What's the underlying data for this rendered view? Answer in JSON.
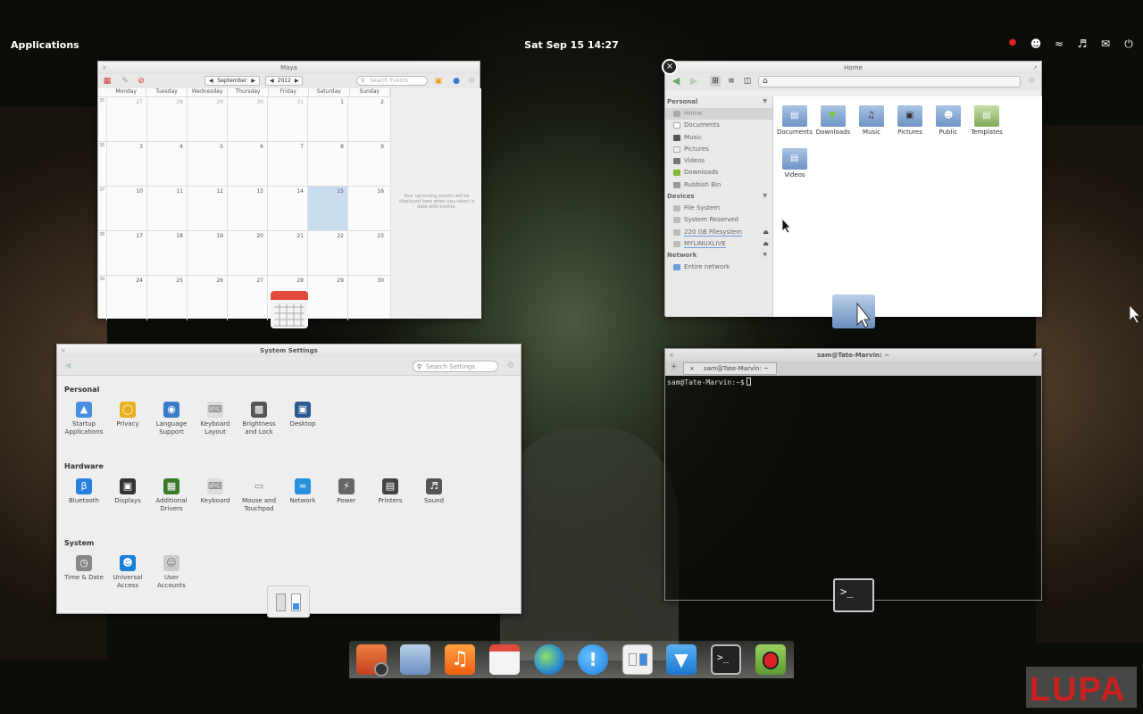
{
  "panel": {
    "applications": "Applications",
    "clock": "Sat Sep 15 14:27",
    "tray_icons": [
      "record-indicator-icon",
      "user-icon",
      "wifi-icon",
      "volume-icon",
      "mail-icon",
      "power-icon"
    ]
  },
  "calendar": {
    "title": "Maya",
    "month": "September",
    "year": "2012",
    "search_placeholder": "Search Events",
    "days": [
      "Monday",
      "Tuesday",
      "Wednesday",
      "Thursday",
      "Friday",
      "Saturday",
      "Sunday"
    ],
    "weeks": [
      {
        "num": "35",
        "dates": [
          "27",
          "28",
          "29",
          "30",
          "31",
          "1",
          "2"
        ]
      },
      {
        "num": "36",
        "dates": [
          "3",
          "4",
          "5",
          "6",
          "7",
          "8",
          "9"
        ]
      },
      {
        "num": "37",
        "dates": [
          "10",
          "11",
          "12",
          "13",
          "14",
          "15",
          "16"
        ]
      },
      {
        "num": "38",
        "dates": [
          "17",
          "18",
          "19",
          "20",
          "21",
          "22",
          "23"
        ]
      },
      {
        "num": "39",
        "dates": [
          "24",
          "25",
          "26",
          "27",
          "28",
          "29",
          "30"
        ]
      }
    ],
    "today": "15",
    "events_note": "Your upcoming events will be displayed here when you select a date with events."
  },
  "files": {
    "title": "Home",
    "sidebar": {
      "personal_label": "Personal",
      "personal": [
        "Home",
        "Documents",
        "Music",
        "Pictures",
        "Videos",
        "Downloads",
        "Rubbish Bin"
      ],
      "devices_label": "Devices",
      "devices": [
        "File System",
        "System Reserved",
        "220 GB Filesystem",
        "MYLINUXLIVE"
      ],
      "network_label": "Network",
      "network": [
        "Entire network"
      ]
    },
    "folders": [
      "Documents",
      "Downloads",
      "Music",
      "Pictures",
      "Public",
      "Templates",
      "Videos"
    ]
  },
  "settings": {
    "title": "System Settings",
    "search_placeholder": "Search Settings",
    "sections": [
      {
        "label": "Personal",
        "items": [
          "Startup Applications",
          "Privacy",
          "Language Support",
          "Keyboard Layout",
          "Brightness and Lock",
          "Desktop"
        ]
      },
      {
        "label": "Hardware",
        "items": [
          "Bluetooth",
          "Displays",
          "Additional Drivers",
          "Keyboard",
          "Mouse and Touchpad",
          "Network",
          "Power",
          "Printers",
          "Sound"
        ]
      },
      {
        "label": "System",
        "items": [
          "Time & Date",
          "Universal Access",
          "User Accounts"
        ]
      }
    ]
  },
  "terminal": {
    "title": "sam@Tate-Marvin: ~",
    "tab_label": "sam@Tate-Marvin: ~",
    "prompt": "sam@Tate-Marvin:~$"
  },
  "dock": {
    "apps": [
      "shotwell-icon",
      "files-icon",
      "music-icon",
      "calendar-icon",
      "browser-icon",
      "chat-icon",
      "settings-icon",
      "downloads-icon",
      "terminal-icon",
      "bug-app-icon"
    ]
  },
  "watermark": "LUPA",
  "colors": {
    "today_highlight": "#c9dcf0",
    "folder_blue": "#6e93c4"
  }
}
